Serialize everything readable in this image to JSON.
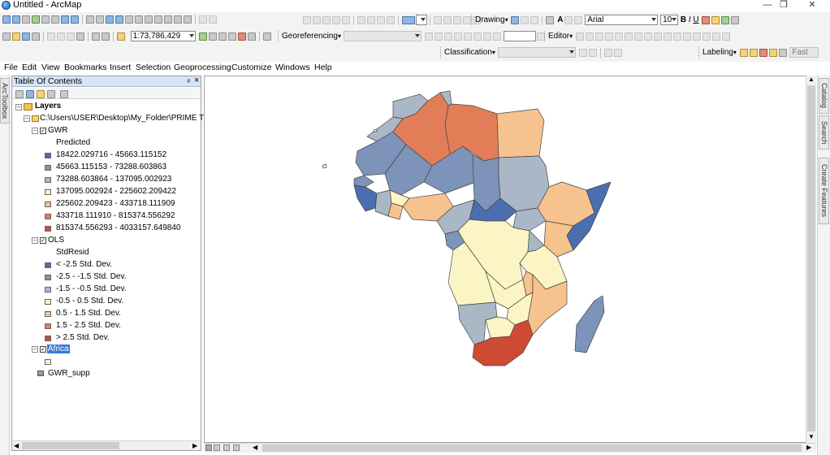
{
  "window": {
    "title": "Untitled - ArcMap",
    "minimize": "—",
    "restore": "❐",
    "close": "✕"
  },
  "toolbar": {
    "scale_value": "1:73,786,429",
    "georeferencing_label": "Georeferencing",
    "drawing_label": "Drawing",
    "font_name": "Arial",
    "font_size": "10",
    "bold": "B",
    "italic": "I",
    "underline": "U",
    "editor_label": "Editor",
    "classification_label": "Classification",
    "labeling_label": "Labeling",
    "fast_label": "Fast",
    "text_tool": "A"
  },
  "menu": {
    "items": [
      "File",
      "Edit",
      "View",
      "Bookmarks",
      "Insert",
      "Selection",
      "Geoprocessing",
      "Customize",
      "Windows",
      "Help"
    ]
  },
  "left_tabs": {
    "arc_toolbox": "ArcToolbox"
  },
  "right_tabs": {
    "catalog": "Catalog",
    "search": "Search",
    "create_features": "Create Features"
  },
  "toc": {
    "title": "Table Of Contents",
    "pin": "ᵖ",
    "close": "×",
    "layers_label": "Layers",
    "folder_path": "C:\\Users\\USER\\Desktop\\My_Folder\\PRIME TEC",
    "gwr": {
      "name": "GWR",
      "field": "Predicted",
      "classes": [
        {
          "label": "18422.029716 - 45663.115152",
          "color": "#4a6eb0"
        },
        {
          "label": "45663.115153 - 73288.603863",
          "color": "#7d93b9"
        },
        {
          "label": "73288.603864 - 137095.002923",
          "color": "#aab7c6"
        },
        {
          "label": "137095.002924 - 225602.209422",
          "color": "#fbf4c4"
        },
        {
          "label": "225602.209423 - 433718.111909",
          "color": "#f6c28e"
        },
        {
          "label": "433718.111910 - 815374.556292",
          "color": "#e27e57"
        },
        {
          "label": "815374.556293 - 4033157.649840",
          "color": "#cf4a33"
        }
      ]
    },
    "ols": {
      "name": "OLS",
      "field": "StdResid",
      "classes": [
        {
          "label": "< -2.5 Std. Dev.",
          "color": "#4a6eb0"
        },
        {
          "label": "-2.5 - -1.5 Std. Dev.",
          "color": "#7d93b9"
        },
        {
          "label": "-1.5 - -0.5 Std. Dev.",
          "color": "#aab7c6"
        },
        {
          "label": "-0.5 - 0.5 Std. Dev.",
          "color": "#fbf4c4"
        },
        {
          "label": "0.5 - 1.5 Std. Dev.",
          "color": "#f6c28e"
        },
        {
          "label": "1.5 - 2.5 Std. Dev.",
          "color": "#e27e57"
        },
        {
          "label": "> 2.5 Std. Dev.",
          "color": "#cf4a33"
        }
      ]
    },
    "africa": {
      "name": "Africa",
      "color": "#fbf4c4"
    },
    "gwr_supp": {
      "name": "GWR_supp",
      "color": "#9a9a9a"
    }
  },
  "map": {
    "background": "#ffffff",
    "border_color": "#444444"
  }
}
